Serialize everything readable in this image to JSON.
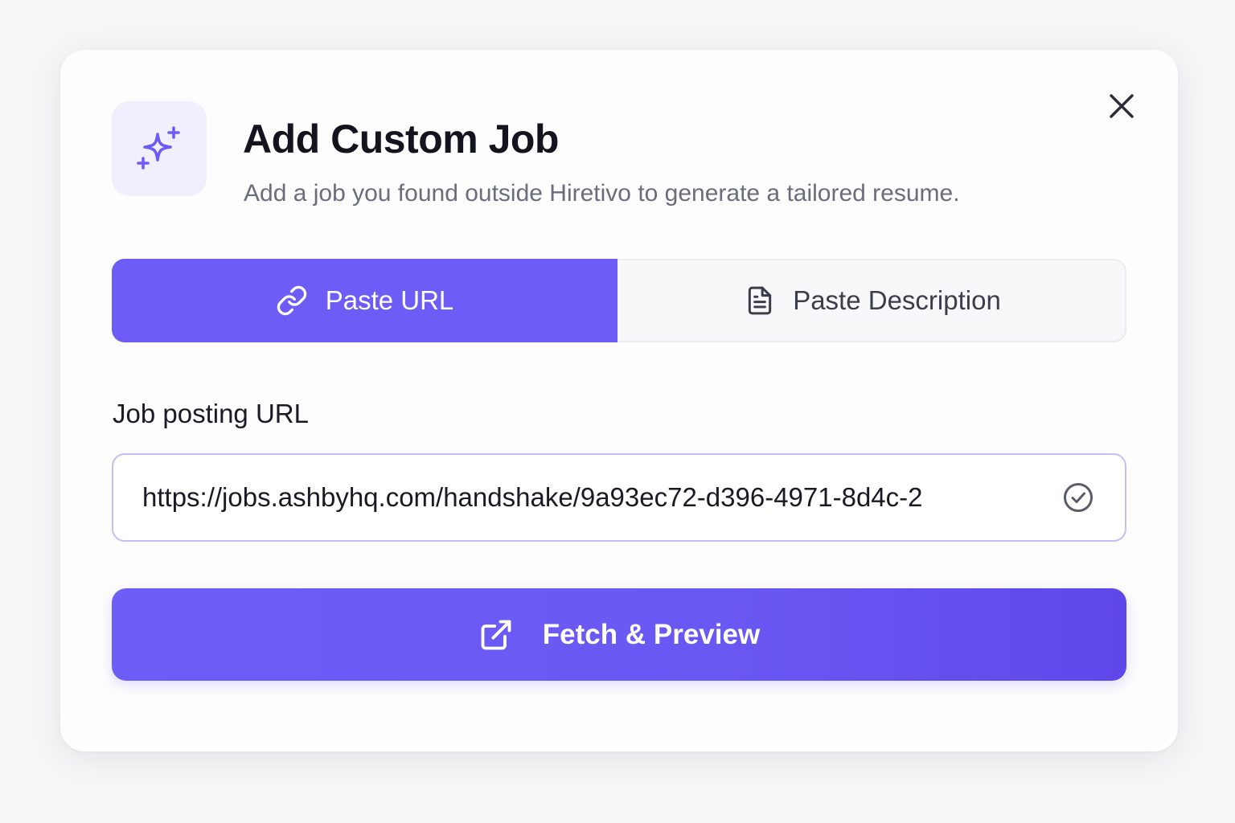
{
  "modal": {
    "title": "Add Custom Job",
    "subtitle": "Add a job you found outside Hiretivo to generate a tailored resume.",
    "header_icon": "sparkle-icon",
    "close_icon": "close-icon"
  },
  "tabs": [
    {
      "label": "Paste URL",
      "icon": "link-icon",
      "active": true
    },
    {
      "label": "Paste Description",
      "icon": "document-icon",
      "active": false
    }
  ],
  "url_field": {
    "label": "Job posting URL",
    "value": "https://jobs.ashbyhq.com/handshake/9a93ec72-d396-4971-8d4c-2",
    "status_icon": "check-circle-icon"
  },
  "fetch_button": {
    "label": "Fetch & Preview",
    "icon": "external-link-icon"
  },
  "colors": {
    "accent": "#6d5cf6",
    "tile_background": "#f1effd",
    "input_border": "#c6bdf7"
  }
}
